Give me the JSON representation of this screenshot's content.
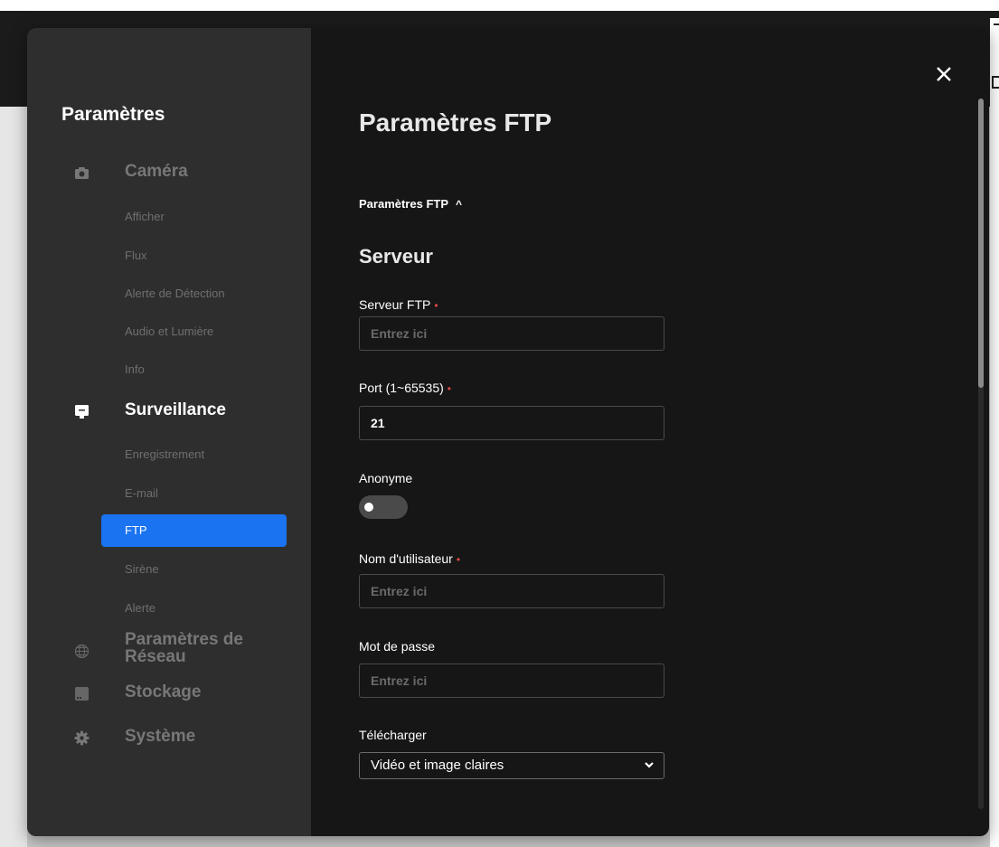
{
  "sidebar": {
    "title": "Paramètres",
    "sections": [
      {
        "label": "Caméra",
        "icon": "camera-icon",
        "items": [
          "Afficher",
          "Flux",
          "Alerte de Détection",
          "Audio et Lumière",
          "Info"
        ]
      },
      {
        "label": "Surveillance",
        "icon": "monitor-icon",
        "items": [
          "Enregistrement",
          "E-mail",
          "FTP",
          "Sirène",
          "Alerte"
        ]
      },
      {
        "label_line1": "Paramètres de",
        "label_line2": "Réseau",
        "icon": "globe-icon"
      },
      {
        "label": "Stockage",
        "icon": "storage-icon"
      },
      {
        "label": "Système",
        "icon": "gear-icon"
      }
    ],
    "active_section": "Surveillance",
    "active_item": "FTP"
  },
  "main": {
    "close_label": "✕",
    "title": "Paramètres FTP",
    "section_toggle": "Paramètres FTP",
    "section_toggle_chevron": "^",
    "subtitle": "Serveur",
    "fields": {
      "server": {
        "label": "Serveur FTP",
        "required_mark": "•",
        "value": "",
        "placeholder": "Entrez ici"
      },
      "port": {
        "label": "Port (1~65535)",
        "required_mark": "•",
        "value": "21",
        "placeholder": ""
      },
      "anonymous": {
        "label": "Anonyme",
        "enabled": false
      },
      "username": {
        "label": "Nom d'utilisateur",
        "required_mark": "•",
        "value": "",
        "placeholder": "Entrez ici"
      },
      "password": {
        "label": "Mot de passe",
        "value": "",
        "placeholder": "Entrez ici"
      },
      "upload": {
        "label": "Télécharger",
        "selected": "Vidéo et image claires"
      }
    }
  },
  "colors": {
    "accent": "#1a73f0",
    "required": "#e04848",
    "sidebar_bg": "#2e2e2e",
    "main_bg": "#161616"
  }
}
